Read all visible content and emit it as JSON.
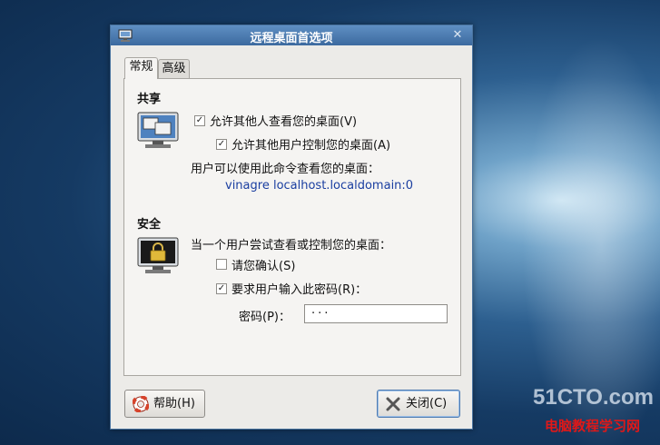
{
  "window": {
    "title": "远程桌面首选项"
  },
  "tabs": [
    {
      "label": "常规"
    },
    {
      "label": "高级"
    }
  ],
  "sharing": {
    "title": "共享",
    "allow_view_label": "允许其他人查看您的桌面(V)",
    "allow_view_checked": true,
    "allow_control_label": "允许其他用户控制您的桌面(A)",
    "allow_control_checked": true,
    "command_text": "用户可以使用此命令查看您的桌面：",
    "command_link": "vinagre localhost.localdomain:0"
  },
  "security": {
    "title": "安全",
    "prompt_text": "当一个用户尝试查看或控制您的桌面：",
    "confirm_label": "请您确认(S)",
    "confirm_checked": false,
    "require_password_label": "要求用户输入此密码(R)：",
    "require_password_checked": true,
    "password_label": "密码(P)：",
    "password_value": "···"
  },
  "buttons": {
    "help": "帮助(H)",
    "close": "关闭(C)"
  },
  "watermark": {
    "line1": "51CTO.com",
    "line2": "电脑教程学习网"
  },
  "colors": {
    "titlebar": "#4a7ab0",
    "link": "#1a3ea0",
    "watermark_red": "#e01818"
  },
  "icons": {
    "app": "remote-desktop-icon",
    "share": "monitor-share-icon",
    "security": "monitor-lock-icon",
    "help": "lifebuoy-icon",
    "close": "close-x-icon"
  }
}
